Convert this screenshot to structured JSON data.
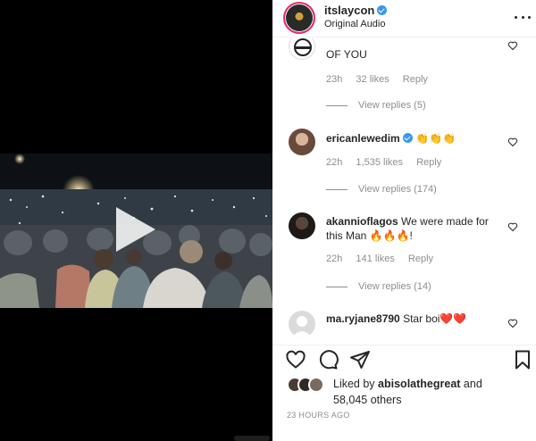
{
  "post": {
    "username": "itslaycon",
    "verified": true,
    "audio": "Original Audio",
    "more_icon": "more-horizontal-icon"
  },
  "comments": [
    {
      "user": "",
      "text": "OF YOU",
      "time": "23h",
      "likes": "32 likes",
      "reply": "Reply",
      "view_replies": "View replies (5)"
    },
    {
      "user": "ericanlewedim",
      "verified": true,
      "text": "👏👏👏",
      "time": "22h",
      "likes": "1,535 likes",
      "reply": "Reply",
      "view_replies": "View replies (174)"
    },
    {
      "user": "akannioflagos",
      "text_line1": "We were made for",
      "text_line2": "this Man 🔥🔥🔥!",
      "time": "22h",
      "likes": "141 likes",
      "reply": "Reply",
      "view_replies": "View replies (14)"
    },
    {
      "user": "ma.ryjane8790",
      "text": "Star boi❤️❤️"
    }
  ],
  "actions": {
    "like_icon": "heart-icon",
    "comment_icon": "comment-icon",
    "share_icon": "send-icon",
    "save_icon": "bookmark-icon"
  },
  "likes": {
    "prefix": "Liked by",
    "user": "abisolathegreat",
    "and": "and",
    "count": "58,045 others"
  },
  "timestamp": "23 HOURS AGO",
  "colors": {
    "verified_blue": "#3897f0",
    "meta_gray": "#8e8e8e",
    "text": "#262626",
    "heart_red": "#ed4956"
  }
}
